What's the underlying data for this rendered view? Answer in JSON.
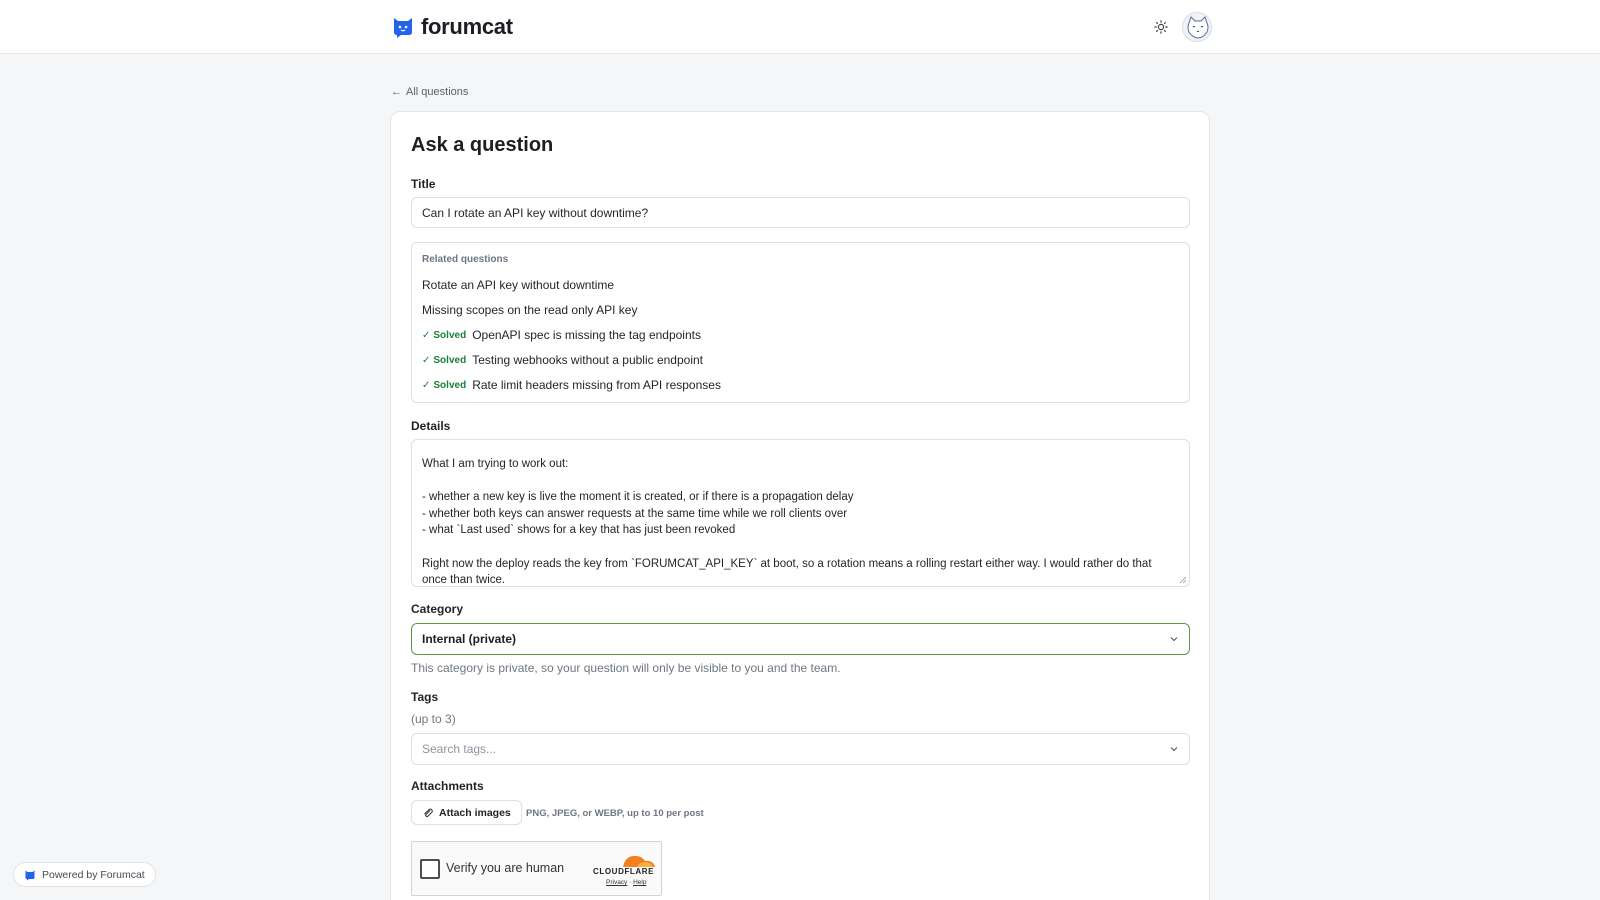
{
  "header": {
    "brand_name": "forumcat",
    "brand_color": "#2563eb"
  },
  "nav": {
    "back_label": "All questions"
  },
  "form": {
    "page_title": "Ask a question",
    "title_label": "Title",
    "title_value": "Can I rotate an API key without downtime?",
    "related": {
      "label": "Related questions",
      "solved_label": "Solved",
      "items": [
        {
          "text": "Rotate an API key without downtime",
          "solved": false
        },
        {
          "text": "Missing scopes on the read only API key",
          "solved": false
        },
        {
          "text": "OpenAPI spec is missing the tag endpoints",
          "solved": true
        },
        {
          "text": "Testing webhooks without a public endpoint",
          "solved": true
        },
        {
          "text": "Rate limit headers missing from API responses",
          "solved": true
        }
      ]
    },
    "details_label": "Details",
    "details_lines": [
      "What I am trying to work out:",
      "",
      "- whether a new key is live the moment it is created, or if there is a propagation delay",
      "- whether both keys can answer requests at the same time while we roll clients over",
      "- what `Last used` shows for a key that has just been revoked",
      "",
      "Right now the deploy reads the key from `FORUMCAT_API_KEY` at boot, so a rotation means a rolling restart either way. I would rather do that once than twice."
    ],
    "category_label": "Category",
    "category_value": "Internal (private)",
    "category_helper": "This category is private, so your question will only be visible to you and the team.",
    "tags_label": "Tags",
    "tags_hint": "(up to 3)",
    "tags_placeholder": "Search tags...",
    "attachments_label": "Attachments",
    "attach_button": "Attach images",
    "attach_note": "PNG, JPEG, or WEBP, up to 10 per post"
  },
  "captcha": {
    "text": "Verify you are human",
    "provider": "CLOUDFLARE",
    "privacy": "Privacy",
    "help": "Help",
    "accent": "#f38020"
  },
  "footer": {
    "powered_by": "Powered by Forumcat"
  }
}
